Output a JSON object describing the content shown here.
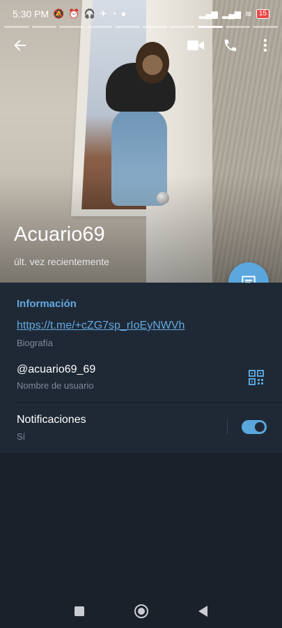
{
  "status_bar": {
    "time": "5:30 PM",
    "battery": "15"
  },
  "profile": {
    "name": "Acuario69",
    "last_seen": "últ. vez recientemente"
  },
  "info": {
    "section_title": "Información",
    "bio_link": "https://t.me/+cZG7sp_rIoEyNWVh",
    "bio_label": "Biografía",
    "username": "@acuario69_69",
    "username_label": "Nombre de usuario",
    "notifications_label": "Notificaciones",
    "notifications_value": "Sí"
  },
  "colors": {
    "accent": "#5aa7de",
    "panel": "#1f2936",
    "background": "#1a212b"
  },
  "icons": [
    "back-arrow-icon",
    "video-call-icon",
    "phone-icon",
    "more-vert-icon",
    "message-icon",
    "qr-code-icon"
  ]
}
